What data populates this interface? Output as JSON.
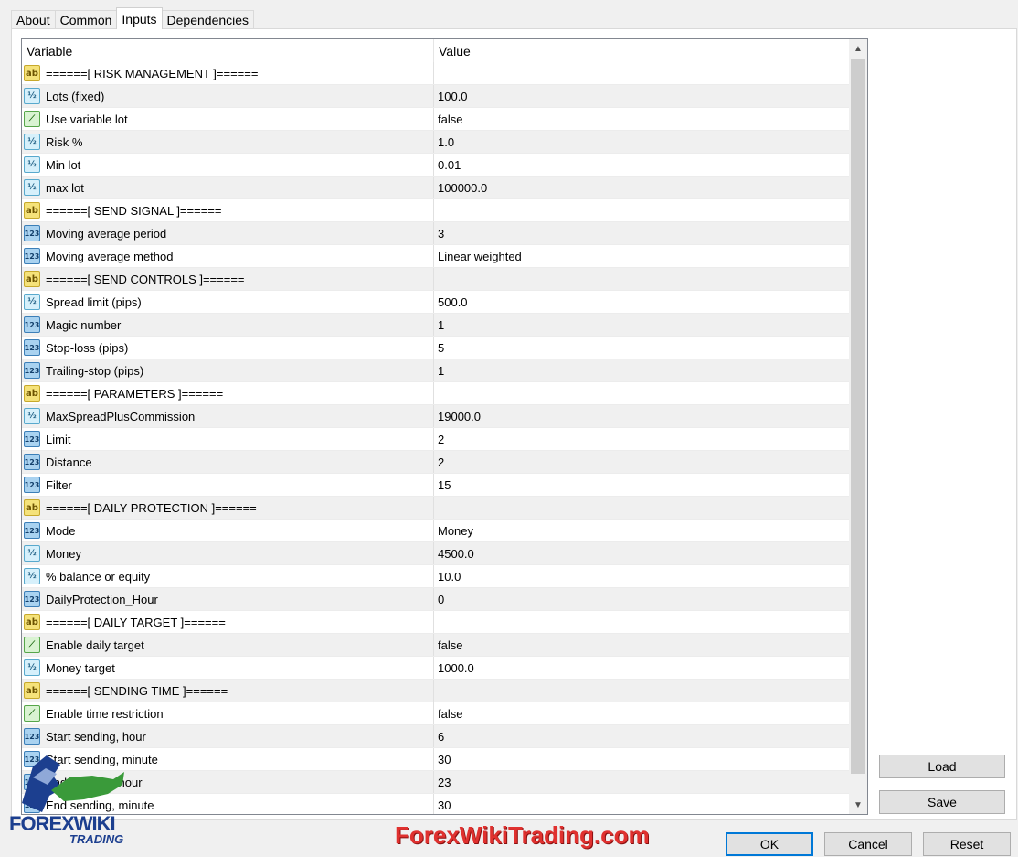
{
  "tabs": [
    {
      "label": "About",
      "active": false
    },
    {
      "label": "Common",
      "active": false
    },
    {
      "label": "Inputs",
      "active": true
    },
    {
      "label": "Dependencies",
      "active": false
    }
  ],
  "grid": {
    "header": {
      "variable": "Variable",
      "value": "Value"
    },
    "rows": [
      {
        "icon": "ab",
        "name": "======[ RISK MANAGEMENT ]======",
        "value": ""
      },
      {
        "icon": "half",
        "name": "Lots (fixed)",
        "value": "100.0"
      },
      {
        "icon": "bool",
        "name": "Use variable lot",
        "value": "false"
      },
      {
        "icon": "half",
        "name": "Risk %",
        "value": "1.0"
      },
      {
        "icon": "half",
        "name": "Min lot",
        "value": "0.01"
      },
      {
        "icon": "half",
        "name": "max lot",
        "value": "100000.0"
      },
      {
        "icon": "ab",
        "name": "======[ SEND SIGNAL ]======",
        "value": ""
      },
      {
        "icon": "num",
        "name": "Moving average period",
        "value": "3"
      },
      {
        "icon": "num",
        "name": "Moving average method",
        "value": "Linear weighted"
      },
      {
        "icon": "ab",
        "name": "======[ SEND CONTROLS ]======",
        "value": ""
      },
      {
        "icon": "half",
        "name": "Spread limit (pips)",
        "value": "500.0"
      },
      {
        "icon": "num",
        "name": "Magic number",
        "value": "1"
      },
      {
        "icon": "num",
        "name": "Stop-loss (pips)",
        "value": "5"
      },
      {
        "icon": "num",
        "name": "Trailing-stop (pips)",
        "value": "1"
      },
      {
        "icon": "ab",
        "name": "======[ PARAMETERS ]======",
        "value": ""
      },
      {
        "icon": "half",
        "name": "MaxSpreadPlusCommission",
        "value": "19000.0"
      },
      {
        "icon": "num",
        "name": "Limit",
        "value": "2"
      },
      {
        "icon": "num",
        "name": "Distance",
        "value": "2"
      },
      {
        "icon": "num",
        "name": "Filter",
        "value": "15"
      },
      {
        "icon": "ab",
        "name": "======[ DAILY PROTECTION ]======",
        "value": ""
      },
      {
        "icon": "num",
        "name": "Mode",
        "value": "Money"
      },
      {
        "icon": "half",
        "name": "Money",
        "value": "4500.0"
      },
      {
        "icon": "half",
        "name": "% balance or equity",
        "value": "10.0"
      },
      {
        "icon": "num",
        "name": "DailyProtection_Hour",
        "value": "0"
      },
      {
        "icon": "ab",
        "name": "======[ DAILY TARGET ]======",
        "value": ""
      },
      {
        "icon": "bool",
        "name": "Enable daily target",
        "value": "false"
      },
      {
        "icon": "half",
        "name": "Money target",
        "value": "1000.0"
      },
      {
        "icon": "ab",
        "name": "======[ SENDING TIME ]======",
        "value": ""
      },
      {
        "icon": "bool",
        "name": "Enable time restriction",
        "value": "false"
      },
      {
        "icon": "num",
        "name": "Start sending, hour",
        "value": "6"
      },
      {
        "icon": "num",
        "name": "Start sending, minute",
        "value": "30"
      },
      {
        "icon": "num",
        "name": "End sending, hour",
        "value": "23"
      },
      {
        "icon": "num",
        "name": "End sending, minute",
        "value": "30"
      }
    ]
  },
  "icon_glyphs": {
    "ab": "ab",
    "half": "½",
    "num": "123",
    "bool": "⟋"
  },
  "icon_names": {
    "ab": "string-type-icon",
    "half": "double-type-icon",
    "num": "integer-type-icon",
    "bool": "bool-type-icon"
  },
  "buttons": {
    "load": "Load",
    "save": "Save",
    "ok": "OK",
    "cancel": "Cancel",
    "reset": "Reset"
  },
  "branding": {
    "logo_line1": "FOREXWIKI",
    "logo_line2": "TRADING",
    "watermark": "ForexWikiTrading.com"
  },
  "colors": {
    "accent": "#0078d7",
    "watermark": "#e0312f",
    "logo": "#1c3f8f"
  }
}
